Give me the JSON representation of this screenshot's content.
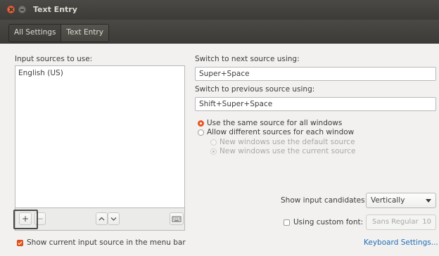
{
  "window": {
    "title": "Text Entry"
  },
  "toolbar": {
    "all_settings": "All Settings",
    "current": "Text Entry"
  },
  "left": {
    "heading": "Input sources to use:",
    "sources": [
      "English (US)"
    ],
    "buttons": {
      "add": "+",
      "remove": "−"
    }
  },
  "right": {
    "next_label": "Switch to next source using:",
    "next_value": "Super+Space",
    "prev_label": "Switch to previous source using:",
    "prev_value": "Shift+Super+Space",
    "radio_same": "Use the same source for all windows",
    "radio_different": "Allow different sources for each window",
    "radio_default": "New windows use the default source",
    "radio_current": "New windows use the current source",
    "candidates_label": "Show input candidates:",
    "candidates_value": "Vertically",
    "custom_font_label": "Using custom font:",
    "font_name": "Sans Regular",
    "font_size": "10",
    "keyboard_settings": "Keyboard Settings..."
  },
  "footer": {
    "show_indicator": "Show current input source in the menu bar"
  },
  "colors": {
    "accent": "#e95420",
    "titlebar": "#3c3b37",
    "link": "#1e6fb8"
  }
}
